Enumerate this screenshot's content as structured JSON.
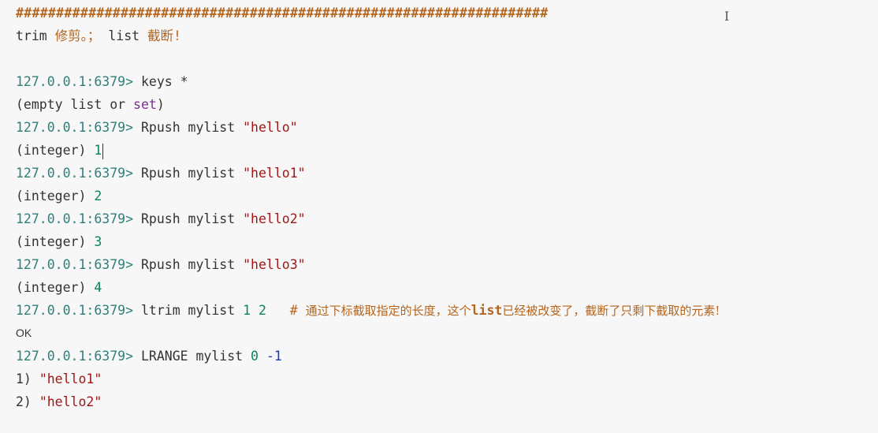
{
  "hash_line": "##################################################################",
  "note": {
    "trim": "trim",
    "trim_cn": " 修剪。；",
    "list": " list",
    "list_cn": " 截断!"
  },
  "prompt": "127.0.0.1:6379> ",
  "lines": {
    "l1_cmd": "keys *",
    "l2_a": "(empty list or ",
    "l2_kw": "set",
    "l2_b": ")",
    "l3_cmd": "Rpush mylist ",
    "l3_str": "\"hello\"",
    "l4_out": "(integer) ",
    "l4_num": "1",
    "l5_cmd": "Rpush mylist ",
    "l5_str": "\"hello1\"",
    "l6_out": "(integer) ",
    "l6_num": "2",
    "l7_cmd": "Rpush mylist ",
    "l7_str": "\"hello2\"",
    "l8_out": "(integer) ",
    "l8_num": "3",
    "l9_cmd": "Rpush mylist ",
    "l9_str": "\"hello3\"",
    "l10_out": "(integer) ",
    "l10_num": "4",
    "l11_cmd": "ltrim mylist ",
    "l11_n1": "1",
    "l11_sp": " ",
    "l11_n2": "2",
    "l11_gap": "   ",
    "l11_hash": "# ",
    "l11_cn1": "通过下标截取指定的长度，这个",
    "l11_list": "list",
    "l11_cn2": "已经被改变了，截断了只剩下截取的元素!",
    "l12_ok": "OK",
    "l13_cmd": "LRANGE mylist ",
    "l13_n1": "0",
    "l13_sp": " ",
    "l13_n2": "-1",
    "l14_idx": "1) ",
    "l14_str": "\"hello1\"",
    "l15_idx": "2) ",
    "l15_str": "\"hello2\""
  },
  "cursor_glyph": "I"
}
